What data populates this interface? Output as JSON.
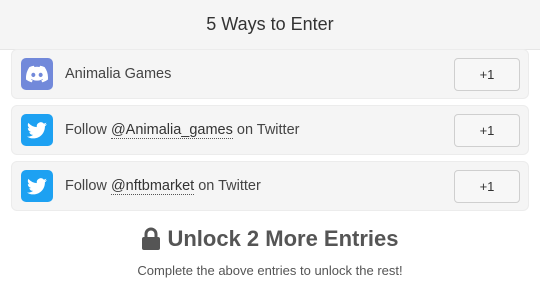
{
  "header": {
    "title": "5 Ways to Enter"
  },
  "entries": [
    {
      "icon": "discord-icon",
      "color": "#7289da",
      "prefix": "Animalia Games",
      "handle": "",
      "suffix": "",
      "points": "+1"
    },
    {
      "icon": "twitter-icon",
      "color": "#1da1f2",
      "prefix": "Follow ",
      "handle": "@Animalia_games",
      "suffix": " on Twitter",
      "points": "+1"
    },
    {
      "icon": "twitter-icon",
      "color": "#1da1f2",
      "prefix": "Follow ",
      "handle": "@nftbmarket",
      "suffix": " on Twitter",
      "points": "+1"
    }
  ],
  "locked": {
    "icon": "lock-icon",
    "title": "Unlock 2 More Entries",
    "subtitle": "Complete the above entries to unlock the rest!"
  }
}
